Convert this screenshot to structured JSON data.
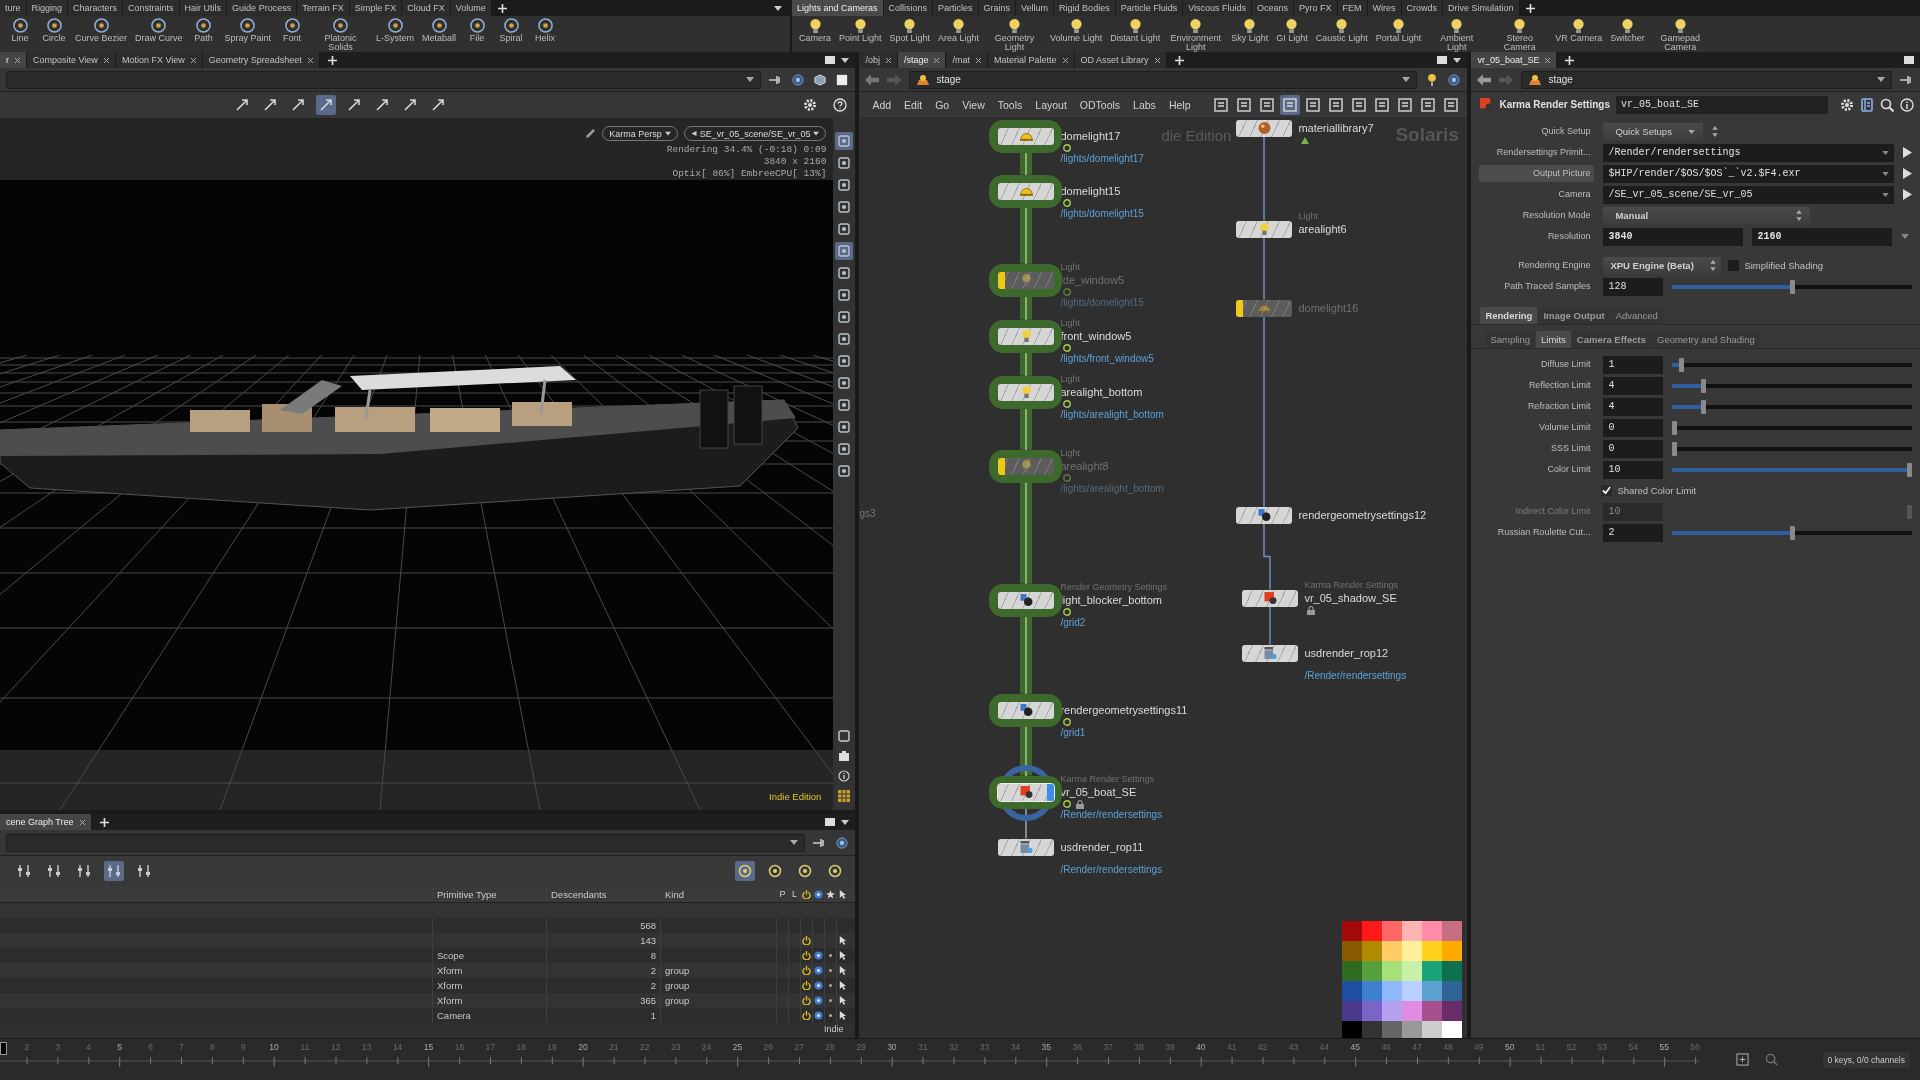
{
  "shelf": {
    "left_tabs": [
      {
        "label": "ture",
        "selected": false
      },
      {
        "label": "Rigging",
        "selected": false
      },
      {
        "label": "Characters",
        "selected": false
      },
      {
        "label": "Constraints",
        "selected": false
      },
      {
        "label": "Hair Utils",
        "selected": false
      },
      {
        "label": "Guide Process",
        "selected": false
      },
      {
        "label": "Terrain FX",
        "selected": false
      },
      {
        "label": "Simple FX",
        "selected": false
      },
      {
        "label": "Cloud FX",
        "selected": false
      },
      {
        "label": "Volume",
        "selected": false
      }
    ],
    "left_tools": [
      "Line",
      "Circle",
      "Curve Bezier",
      "Draw Curve",
      "Path",
      "Spray Paint",
      "Font",
      "Platonic Solids",
      "L-System",
      "Metaball",
      "File",
      "Spiral",
      "Helix"
    ],
    "right_tabs": [
      {
        "label": "Lights and Cameras",
        "selected": true
      },
      {
        "label": "Collisions",
        "selected": false
      },
      {
        "label": "Particles",
        "selected": false
      },
      {
        "label": "Grains",
        "selected": false
      },
      {
        "label": "Vellum",
        "selected": false
      },
      {
        "label": "Rigid Bodies",
        "selected": false
      },
      {
        "label": "Particle Fluids",
        "selected": false
      },
      {
        "label": "Viscous Fluids",
        "selected": false
      },
      {
        "label": "Oceans",
        "selected": false
      },
      {
        "label": "Pyro FX",
        "selected": false
      },
      {
        "label": "FEM",
        "selected": false
      },
      {
        "label": "Wires",
        "selected": false
      },
      {
        "label": "Crowds",
        "selected": false
      },
      {
        "label": "Drive Simulation",
        "selected": false
      }
    ],
    "right_tools": [
      "Camera",
      "Point Light",
      "Spot Light",
      "Area Light",
      "Geometry Light",
      "Volume Light",
      "Distant Light",
      "Environment Light",
      "Sky Light",
      "GI Light",
      "Caustic Light",
      "Portal Light",
      "Ambient Light",
      "Stereo Camera",
      "VR Camera",
      "Switcher",
      "Gamepad Camera"
    ]
  },
  "viewport_pane": {
    "pane_tabs": [
      {
        "label": "r",
        "selected": true
      },
      {
        "label": "Composite View",
        "selected": false
      },
      {
        "label": "Motion FX View",
        "selected": false
      },
      {
        "label": "Geometry Spreadsheet",
        "selected": false
      }
    ],
    "toolbar": [
      {
        "selected": false
      },
      {
        "selected": false
      },
      {
        "selected": false
      },
      {
        "selected": true
      },
      {
        "selected": false
      },
      {
        "selected": false
      },
      {
        "selected": false
      },
      {
        "selected": false
      }
    ],
    "side_tools": [
      {
        "selected": true
      },
      {
        "selected": false
      },
      {
        "selected": false
      },
      {
        "selected": false
      },
      {
        "selected": false
      },
      {
        "selected": true
      },
      {
        "selected": false
      },
      {
        "selected": false
      },
      {
        "selected": false
      },
      {
        "selected": false
      },
      {
        "selected": false
      },
      {
        "selected": false
      },
      {
        "selected": false
      },
      {
        "selected": false
      },
      {
        "selected": false
      },
      {
        "selected": false
      }
    ],
    "camera_menu": "Karma Persp",
    "camera_path": "SE_vr_05_scene/SE_vr_05",
    "render_status": "Rendering 34.4% (-0:18) 0:09",
    "resolution": "3840 x 2160",
    "devices": "Optix[ 86%] EmbreeCPU[ 13%]",
    "edition": "Indie Edition"
  },
  "network": {
    "pane_tabs": [
      {
        "label": "/obj",
        "selected": false
      },
      {
        "label": "/stage",
        "selected": true
      },
      {
        "label": "/mat",
        "selected": false
      },
      {
        "label": "Material Palette",
        "selected": false
      },
      {
        "label": "OD Asset Library",
        "selected": false
      }
    ],
    "path": "stage",
    "menu": [
      "Add",
      "Edit",
      "Go",
      "View",
      "Tools",
      "Layout",
      "ODTools",
      "Labs",
      "Help"
    ],
    "toolbar": [
      {
        "selected": false
      },
      {
        "selected": false
      },
      {
        "selected": false
      },
      {
        "selected": true
      },
      {
        "selected": false
      },
      {
        "selected": false
      },
      {
        "selected": false
      },
      {
        "selected": false
      },
      {
        "selected": false
      },
      {
        "selected": false
      },
      {
        "selected": false
      }
    ],
    "context_label": "Solaris",
    "edition_fragment": "die Edition",
    "edge_fragment": "gs3",
    "left_nodes": [
      {
        "kind": "domelight",
        "name": "domelight17",
        "path": "/lights/domelight17",
        "bypassed": false,
        "highlighted": true,
        "selected": false,
        "display": false,
        "locked": false
      },
      {
        "kind": "domelight",
        "name": "domelight15",
        "path": "/lights/domelight15",
        "bypassed": false,
        "highlighted": true,
        "selected": false,
        "display": false,
        "locked": false
      },
      {
        "kind": "light",
        "type_label": "Light",
        "name": "ide_window5",
        "path": "/lights/domelight15",
        "bypassed": true,
        "highlighted": true,
        "selected": false,
        "display": false,
        "locked": false
      },
      {
        "kind": "light",
        "type_label": "Light",
        "name": "front_window5",
        "path": "/lights/front_window5",
        "bypassed": false,
        "highlighted": true,
        "selected": false,
        "display": false,
        "locked": false
      },
      {
        "kind": "light",
        "type_label": "Light",
        "name": "arealight_bottom",
        "path": "/lights/arealight_bottom",
        "bypassed": false,
        "highlighted": true,
        "selected": false,
        "display": false,
        "locked": false
      },
      {
        "kind": "light",
        "type_label": "Light",
        "name": "arealight8",
        "path": "/lights/arealight_bottom",
        "bypassed": true,
        "highlighted": true,
        "selected": false,
        "display": false,
        "locked": false
      },
      {
        "kind": "geometry",
        "type_label": "Render Geometry Settings",
        "name": "light_blocker_bottom",
        "path": "/grid2",
        "bypassed": false,
        "highlighted": true,
        "selected": false,
        "display": false,
        "locked": false
      },
      {
        "kind": "geometry",
        "name": "rendergeometrysettings11",
        "path": "/grid1",
        "bypassed": false,
        "highlighted": true,
        "selected": false,
        "display": false,
        "locked": false
      },
      {
        "kind": "karma",
        "type_label": "Karma Render Settings",
        "name": "vr_05_boat_SE",
        "path": "/Render/rendersettings",
        "bypassed": false,
        "highlighted": true,
        "selected": true,
        "display": true,
        "locked": true
      },
      {
        "kind": "rop",
        "name": "usdrender_rop11",
        "path": "/Render/rendersettings",
        "bypassed": false,
        "highlighted": false,
        "selected": false,
        "display": false,
        "locked": false
      }
    ],
    "right_nodes": [
      {
        "kind": "material",
        "name": "materiallibrary7",
        "bypassed": false,
        "highlighted": false,
        "selected": false,
        "display": false,
        "locked": false
      },
      {
        "kind": "light",
        "type_label": "Light",
        "name": "arealight6",
        "bypassed": false,
        "highlighted": false,
        "selected": false,
        "display": false,
        "locked": false
      },
      {
        "kind": "domelight",
        "name": "domelight16",
        "bypassed": true,
        "highlighted": false,
        "selected": false,
        "display": false,
        "locked": false
      },
      {
        "kind": "geometry",
        "name": "rendergeometrysettings12",
        "bypassed": false,
        "highlighted": false,
        "selected": false,
        "display": false,
        "locked": false
      },
      {
        "kind": "karma",
        "type_label": "Karma Render Settings",
        "name": "vr_05_shadow_SE",
        "bypassed": false,
        "highlighted": false,
        "selected": false,
        "display": false,
        "locked": true
      },
      {
        "kind": "rop",
        "name": "usdrender_rop12",
        "path": "/Render/rendersettings",
        "bypassed": false,
        "highlighted": false,
        "selected": false,
        "display": false,
        "locked": false
      }
    ],
    "swatches": [
      {
        "color": "#a50a0a"
      },
      {
        "color": "#ff1a1a"
      },
      {
        "color": "#ff6666"
      },
      {
        "color": "#ffb3b3"
      },
      {
        "color": "#ff8ca8"
      },
      {
        "color": "#c86e82"
      },
      {
        "color": "#8a5a00"
      },
      {
        "color": "#b08a00"
      },
      {
        "color": "#ffcc66"
      },
      {
        "color": "#fff099"
      },
      {
        "color": "#ffd21e"
      },
      {
        "color": "#ffaa00"
      },
      {
        "color": "#2e6b1f"
      },
      {
        "color": "#55a03a"
      },
      {
        "color": "#a6e07a"
      },
      {
        "color": "#c8f0a8"
      },
      {
        "color": "#1aa37a"
      },
      {
        "color": "#0f7050"
      },
      {
        "color": "#1e4ea0"
      },
      {
        "color": "#3f7fd0"
      },
      {
        "color": "#8fb8ff"
      },
      {
        "color": "#b8d0ff"
      },
      {
        "color": "#5aa0d0"
      },
      {
        "color": "#2f6496"
      },
      {
        "color": "#4b3a8c"
      },
      {
        "color": "#7a64c8"
      },
      {
        "color": "#b8a0f0"
      },
      {
        "color": "#e08ce0"
      },
      {
        "color": "#a8508c"
      },
      {
        "color": "#6a2d6a"
      },
      {
        "color": "#000000"
      },
      {
        "color": "#333333"
      },
      {
        "color": "#666666"
      },
      {
        "color": "#999999"
      },
      {
        "color": "#cccccc"
      },
      {
        "color": "#ffffff"
      }
    ]
  },
  "params": {
    "pane_tabs": [
      {
        "label": "vr_05_boat_SE",
        "selected": true
      }
    ],
    "path": "stage",
    "node_type": "Karma Render Settings",
    "node_name": "vr_05_boat_SE",
    "rows": [
      {
        "kind": "button_menu",
        "label": "Quick Setup",
        "value": "Quick Setups",
        "emphasized": false
      },
      {
        "kind": "path",
        "label": "Rendersettings Primit...",
        "value": "/Render/rendersettings",
        "emphasized": false
      },
      {
        "kind": "path",
        "label": "Output Picture",
        "value": "$HIP/render/$OS/$OS`_`v2.$F4.exr",
        "emphasized": true
      },
      {
        "kind": "path",
        "label": "Camera",
        "value": "/SE_vr_05_scene/SE_vr_05",
        "emphasized": false
      },
      {
        "kind": "menu",
        "label": "Resolution Mode",
        "value": "Manual",
        "emphasized": false
      },
      {
        "kind": "pair",
        "label": "Resolution",
        "values": [
          "3840",
          "2160"
        ],
        "emphasized": false
      },
      {
        "kind": "engine",
        "label": "Rendering Engine",
        "value": "XPU Engine (Beta)",
        "check_label": "Simplified Shading",
        "checked": false,
        "emphasized": false
      },
      {
        "kind": "slider",
        "label": "Path Traced Samples",
        "value": "128",
        "level": 0.5,
        "emphasized": false
      }
    ],
    "section_tabs": [
      {
        "label": "Rendering",
        "selected": true,
        "modified": true
      },
      {
        "label": "Image Output",
        "selected": false,
        "modified": true
      },
      {
        "label": "Advanced",
        "selected": false,
        "modified": false
      }
    ],
    "subtabs": [
      {
        "label": "Sampling",
        "selected": false,
        "modified": false
      },
      {
        "label": "Limits",
        "selected": true,
        "modified": false
      },
      {
        "label": "Camera Effects",
        "selected": false,
        "modified": true
      },
      {
        "label": "Geometry and Shading",
        "selected": false,
        "modified": false
      }
    ],
    "limits": [
      {
        "kind": "slider",
        "label": "Diffuse Limit",
        "value": "1",
        "level": 0.03,
        "disabled": false
      },
      {
        "kind": "slider",
        "label": "Reflection Limit",
        "value": "4",
        "level": 0.12,
        "disabled": false
      },
      {
        "kind": "slider",
        "label": "Refraction Limit",
        "value": "4",
        "level": 0.12,
        "disabled": false
      },
      {
        "kind": "slider",
        "label": "Volume Limit",
        "value": "0",
        "level": 0,
        "disabled": false
      },
      {
        "kind": "slider",
        "label": "SSS Limit",
        "value": "0",
        "level": 0,
        "disabled": false
      },
      {
        "kind": "slider",
        "label": "Color Limit",
        "value": "10",
        "level": 1,
        "disabled": false
      },
      {
        "kind": "checkbox",
        "label": "Shared Color Limit",
        "checked": true,
        "disabled": false
      },
      {
        "kind": "slider",
        "label": "Indirect Color Limit",
        "value": "10",
        "level": 1,
        "disabled": true
      },
      {
        "kind": "slider",
        "label": "Russian Roulette Cut...",
        "value": "2",
        "level": 0.5,
        "disabled": false
      }
    ]
  },
  "scene_graph": {
    "pane_tabs": [
      {
        "label": "cene Graph Tree",
        "selected": true
      }
    ],
    "toolbar": [
      {
        "selected": false
      },
      {
        "selected": false
      },
      {
        "selected": false
      },
      {
        "selected": true
      },
      {
        "selected": false
      }
    ],
    "toolbar_right": [
      {
        "selected": true
      },
      {
        "selected": false
      },
      {
        "selected": false
      },
      {
        "selected": false
      }
    ],
    "columns": [
      "Primitive Type",
      "Descendants",
      "Kind",
      "P",
      "L"
    ],
    "rows": [
      {
        "descendants": "568",
        "active": false,
        "visible": false
      },
      {
        "descendants": "143",
        "active": true,
        "visible": false
      },
      {
        "type": "Scope",
        "descendants": "8",
        "active": true,
        "visible": true
      },
      {
        "type": "Xform",
        "descendants": "2",
        "prim_kind": "group",
        "active": true,
        "visible": true
      },
      {
        "type": "Xform",
        "descendants": "2",
        "prim_kind": "group",
        "active": true,
        "visible": true
      },
      {
        "type": "Xform",
        "descendants": "365",
        "prim_kind": "group",
        "active": true,
        "visible": true
      },
      {
        "type": "Camera",
        "descendants": "1",
        "active": true,
        "visible": true
      }
    ],
    "edition_fragment": "Indie"
  },
  "timeline": {
    "frames": [
      "2",
      "3",
      "4",
      "5",
      "6",
      "7",
      "8",
      "9",
      "10",
      "11",
      "12",
      "13",
      "14",
      "15",
      "16",
      "17",
      "18",
      "19",
      "20",
      "21",
      "22",
      "23",
      "24",
      "25",
      "26",
      "27",
      "28",
      "29",
      "30",
      "31",
      "32",
      "33",
      "34",
      "35",
      "36",
      "37",
      "38",
      "39",
      "40",
      "41",
      "42",
      "43",
      "44",
      "45",
      "46",
      "47",
      "48",
      "49",
      "50",
      "51",
      "52",
      "53",
      "54",
      "55",
      "56"
    ],
    "status": "0 keys, 0/0 channels"
  }
}
